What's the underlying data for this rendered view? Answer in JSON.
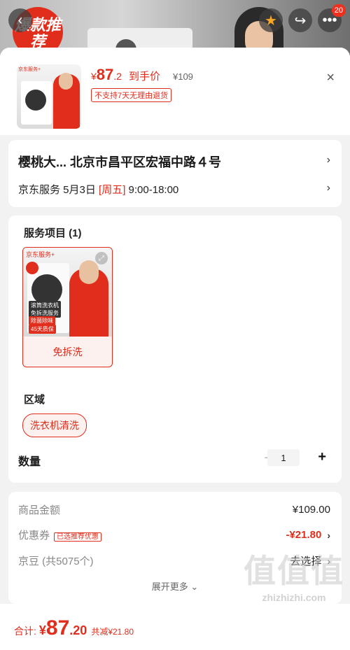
{
  "banner": {
    "badge_text": "爆款推荐",
    "cart_count": "20"
  },
  "header": {
    "price_currency": "¥",
    "price_integer": "87",
    "price_decimal": ".2",
    "price_label": "到手价",
    "original_price": "¥109",
    "no_return_notice": "不支持7天无理由退货",
    "close_glyph": "×",
    "thumb_tag": "京东服务+"
  },
  "address": {
    "line": "樱桃大...  北京市昌平区宏福中路４号",
    "service_prefix": "京东服务 5月3日 ",
    "service_day": "[周五]",
    "service_time": " 9:00-18:00"
  },
  "options": {
    "service_section_title": "服务项目 (1)",
    "service_item": {
      "image_tag": "京东服务+",
      "pill_1": "滚筒洗衣机",
      "pill_2": "免拆洗服务",
      "pill_3": "除菌除味",
      "pill_4": "45天质保",
      "name": "免拆洗"
    },
    "region_title": "区域",
    "region_value": "洗衣机清洗",
    "quantity_label": "数量",
    "quantity_value": "1",
    "minus_glyph": "−",
    "plus_glyph": "+"
  },
  "fees": {
    "goods_label": "商品金额",
    "goods_value": "¥109.00",
    "coupon_label": "优惠券",
    "coupon_tag": "已选推荐优惠",
    "coupon_value": "-¥21.80",
    "beans_label": "京豆 (共5075个)",
    "beans_value": "去选择",
    "expand_more": "展开更多 ⌄"
  },
  "footer": {
    "total_label": "合计:",
    "total_currency": "¥",
    "total_integer": "87",
    "total_decimal": ".20",
    "total_saved": "共减¥21.80"
  },
  "watermark": {
    "glyphs": "值值值",
    "url": "zhizhizhi.com"
  },
  "colors": {
    "accent": "#e02d1c",
    "background": "#f2f2f2"
  }
}
